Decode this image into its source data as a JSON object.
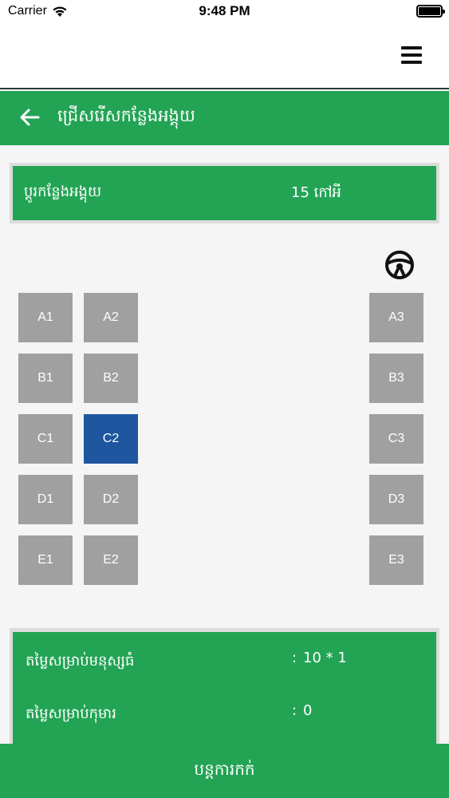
{
  "status_bar": {
    "carrier": "Carrier",
    "time": "9:48 PM"
  },
  "header": {
    "title": "ជ្រើសរើសកន្លែងអង្គុយ"
  },
  "route": {
    "label": "ប្ដូរកន្លែងអង្គុយ",
    "value": "15  កៅអី"
  },
  "seats": {
    "row_a": [
      "A1",
      "A2",
      "A3"
    ],
    "row_b": [
      "B1",
      "B2",
      "B3"
    ],
    "row_c": [
      "C1",
      "C2",
      "C3"
    ],
    "row_d": [
      "D1",
      "D2",
      "D3"
    ],
    "row_e": [
      "E1",
      "E2",
      "E3"
    ],
    "selected": "C2"
  },
  "summary": {
    "adult_label": "តម្លៃសម្រាប់មនុស្សធំ",
    "adult_value": "10 * 1",
    "child_label": "តម្លៃសម្រាប់កុមារ",
    "child_value": "0",
    "colon": ":"
  },
  "footer": {
    "continue_label": "បន្តការកក់"
  },
  "colors": {
    "primary_green": "#22a454",
    "seat_available": "#a0a0a0",
    "seat_selected": "#1e56a0"
  }
}
